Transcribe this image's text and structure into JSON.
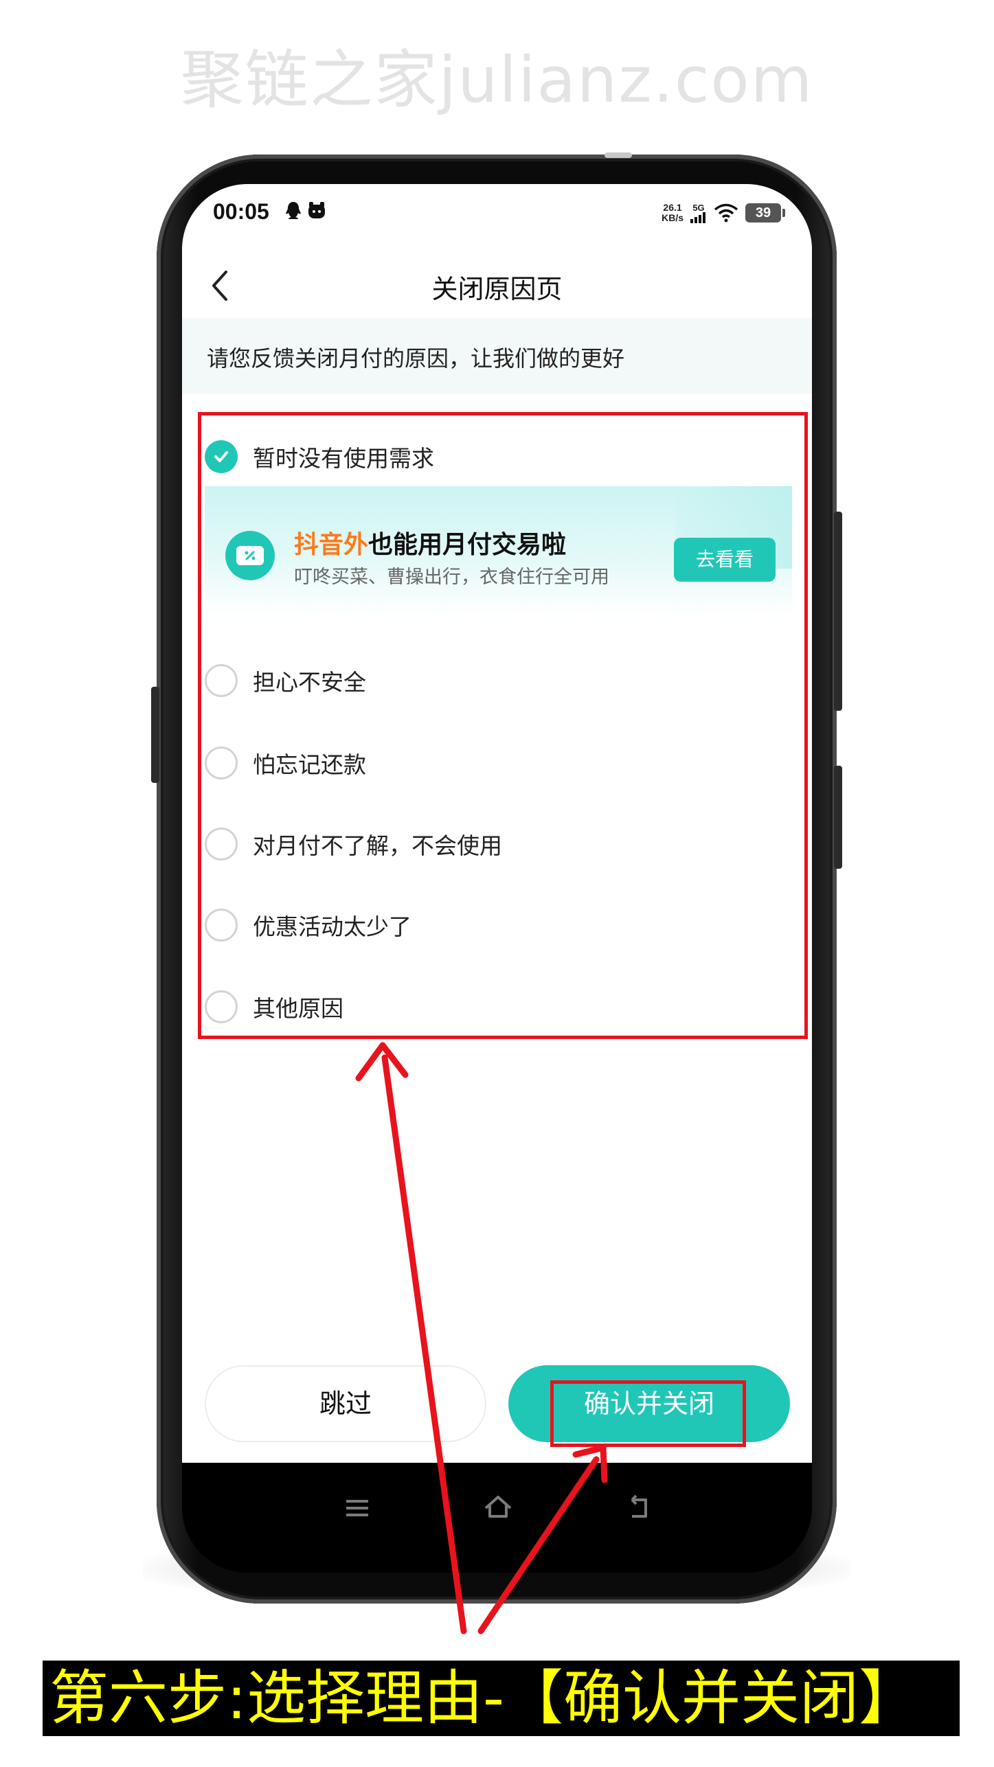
{
  "watermark": "聚链之家julianz.com",
  "status_bar": {
    "time": "00:05",
    "net_speed": "26.1",
    "net_unit": "KB/s",
    "network": "5G",
    "battery": "39"
  },
  "header": {
    "title": "关闭原因页"
  },
  "hint": "请您反馈关闭月付的原因，让我们做的更好",
  "options": [
    {
      "label": "暂时没有使用需求",
      "checked": true
    },
    {
      "label": "担心不安全",
      "checked": false
    },
    {
      "label": "怕忘记还款",
      "checked": false
    },
    {
      "label": "对月付不了解，不会使用",
      "checked": false
    },
    {
      "label": "优惠活动太少了",
      "checked": false
    },
    {
      "label": "其他原因",
      "checked": false
    }
  ],
  "promo": {
    "title_highlight": "抖音外",
    "title_rest": "也能用月付交易啦",
    "subtitle": "叮咚买菜、曹操出行，衣食住行全可用",
    "button": "去看看"
  },
  "footer": {
    "skip_label": "跳过",
    "confirm_label": "确认并关闭"
  },
  "caption": "第六步:选择理由-【确认并关闭】",
  "colors": {
    "accent": "#20c7b7",
    "highlight_orange": "#ff7a1a",
    "annotation_red": "#e8131d",
    "caption_bg": "#000000",
    "caption_text": "#ffff00"
  }
}
